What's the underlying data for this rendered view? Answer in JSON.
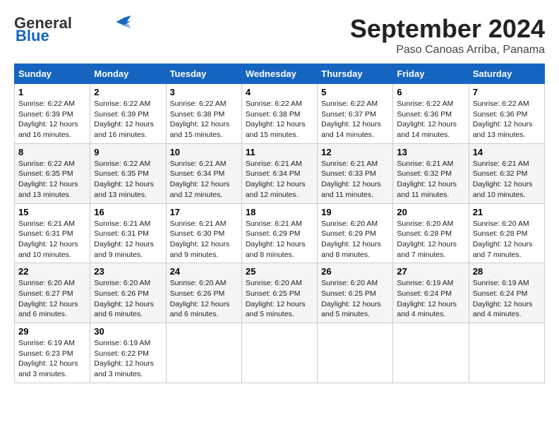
{
  "header": {
    "logo_general": "General",
    "logo_blue": "Blue",
    "month_title": "September 2024",
    "location": "Paso Canoas Arriba, Panama"
  },
  "weekdays": [
    "Sunday",
    "Monday",
    "Tuesday",
    "Wednesday",
    "Thursday",
    "Friday",
    "Saturday"
  ],
  "weeks": [
    [
      {
        "day": "1",
        "sunrise": "6:22 AM",
        "sunset": "6:39 PM",
        "daylight": "12 hours and 16 minutes."
      },
      {
        "day": "2",
        "sunrise": "6:22 AM",
        "sunset": "6:39 PM",
        "daylight": "12 hours and 16 minutes."
      },
      {
        "day": "3",
        "sunrise": "6:22 AM",
        "sunset": "6:38 PM",
        "daylight": "12 hours and 15 minutes."
      },
      {
        "day": "4",
        "sunrise": "6:22 AM",
        "sunset": "6:38 PM",
        "daylight": "12 hours and 15 minutes."
      },
      {
        "day": "5",
        "sunrise": "6:22 AM",
        "sunset": "6:37 PM",
        "daylight": "12 hours and 14 minutes."
      },
      {
        "day": "6",
        "sunrise": "6:22 AM",
        "sunset": "6:36 PM",
        "daylight": "12 hours and 14 minutes."
      },
      {
        "day": "7",
        "sunrise": "6:22 AM",
        "sunset": "6:36 PM",
        "daylight": "12 hours and 13 minutes."
      }
    ],
    [
      {
        "day": "8",
        "sunrise": "6:22 AM",
        "sunset": "6:35 PM",
        "daylight": "12 hours and 13 minutes."
      },
      {
        "day": "9",
        "sunrise": "6:22 AM",
        "sunset": "6:35 PM",
        "daylight": "12 hours and 13 minutes."
      },
      {
        "day": "10",
        "sunrise": "6:21 AM",
        "sunset": "6:34 PM",
        "daylight": "12 hours and 12 minutes."
      },
      {
        "day": "11",
        "sunrise": "6:21 AM",
        "sunset": "6:34 PM",
        "daylight": "12 hours and 12 minutes."
      },
      {
        "day": "12",
        "sunrise": "6:21 AM",
        "sunset": "6:33 PM",
        "daylight": "12 hours and 11 minutes."
      },
      {
        "day": "13",
        "sunrise": "6:21 AM",
        "sunset": "6:32 PM",
        "daylight": "12 hours and 11 minutes."
      },
      {
        "day": "14",
        "sunrise": "6:21 AM",
        "sunset": "6:32 PM",
        "daylight": "12 hours and 10 minutes."
      }
    ],
    [
      {
        "day": "15",
        "sunrise": "6:21 AM",
        "sunset": "6:31 PM",
        "daylight": "12 hours and 10 minutes."
      },
      {
        "day": "16",
        "sunrise": "6:21 AM",
        "sunset": "6:31 PM",
        "daylight": "12 hours and 9 minutes."
      },
      {
        "day": "17",
        "sunrise": "6:21 AM",
        "sunset": "6:30 PM",
        "daylight": "12 hours and 9 minutes."
      },
      {
        "day": "18",
        "sunrise": "6:21 AM",
        "sunset": "6:29 PM",
        "daylight": "12 hours and 8 minutes."
      },
      {
        "day": "19",
        "sunrise": "6:20 AM",
        "sunset": "6:29 PM",
        "daylight": "12 hours and 8 minutes."
      },
      {
        "day": "20",
        "sunrise": "6:20 AM",
        "sunset": "6:28 PM",
        "daylight": "12 hours and 7 minutes."
      },
      {
        "day": "21",
        "sunrise": "6:20 AM",
        "sunset": "6:28 PM",
        "daylight": "12 hours and 7 minutes."
      }
    ],
    [
      {
        "day": "22",
        "sunrise": "6:20 AM",
        "sunset": "6:27 PM",
        "daylight": "12 hours and 6 minutes."
      },
      {
        "day": "23",
        "sunrise": "6:20 AM",
        "sunset": "6:26 PM",
        "daylight": "12 hours and 6 minutes."
      },
      {
        "day": "24",
        "sunrise": "6:20 AM",
        "sunset": "6:26 PM",
        "daylight": "12 hours and 6 minutes."
      },
      {
        "day": "25",
        "sunrise": "6:20 AM",
        "sunset": "6:25 PM",
        "daylight": "12 hours and 5 minutes."
      },
      {
        "day": "26",
        "sunrise": "6:20 AM",
        "sunset": "6:25 PM",
        "daylight": "12 hours and 5 minutes."
      },
      {
        "day": "27",
        "sunrise": "6:19 AM",
        "sunset": "6:24 PM",
        "daylight": "12 hours and 4 minutes."
      },
      {
        "day": "28",
        "sunrise": "6:19 AM",
        "sunset": "6:24 PM",
        "daylight": "12 hours and 4 minutes."
      }
    ],
    [
      {
        "day": "29",
        "sunrise": "6:19 AM",
        "sunset": "6:23 PM",
        "daylight": "12 hours and 3 minutes."
      },
      {
        "day": "30",
        "sunrise": "6:19 AM",
        "sunset": "6:22 PM",
        "daylight": "12 hours and 3 minutes."
      },
      null,
      null,
      null,
      null,
      null
    ]
  ],
  "labels": {
    "sunrise": "Sunrise:",
    "sunset": "Sunset:",
    "daylight": "Daylight:"
  }
}
